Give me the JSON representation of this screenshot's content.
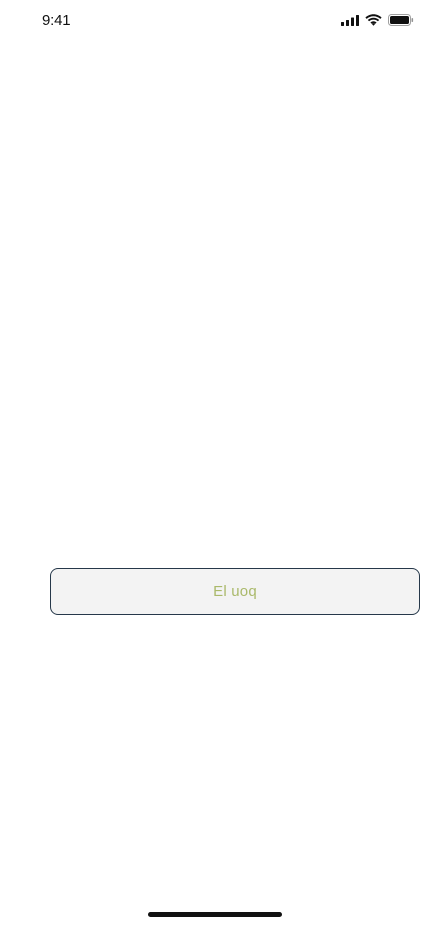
{
  "status_bar": {
    "time": "9:41",
    "icons": [
      "cellular-signal-icon",
      "wifi-icon",
      "battery-icon"
    ]
  },
  "main": {
    "button_label": "El uoq",
    "button_text_color": "#aab96a",
    "button_border_color": "#26384a",
    "button_background": "#f3f3f3"
  }
}
